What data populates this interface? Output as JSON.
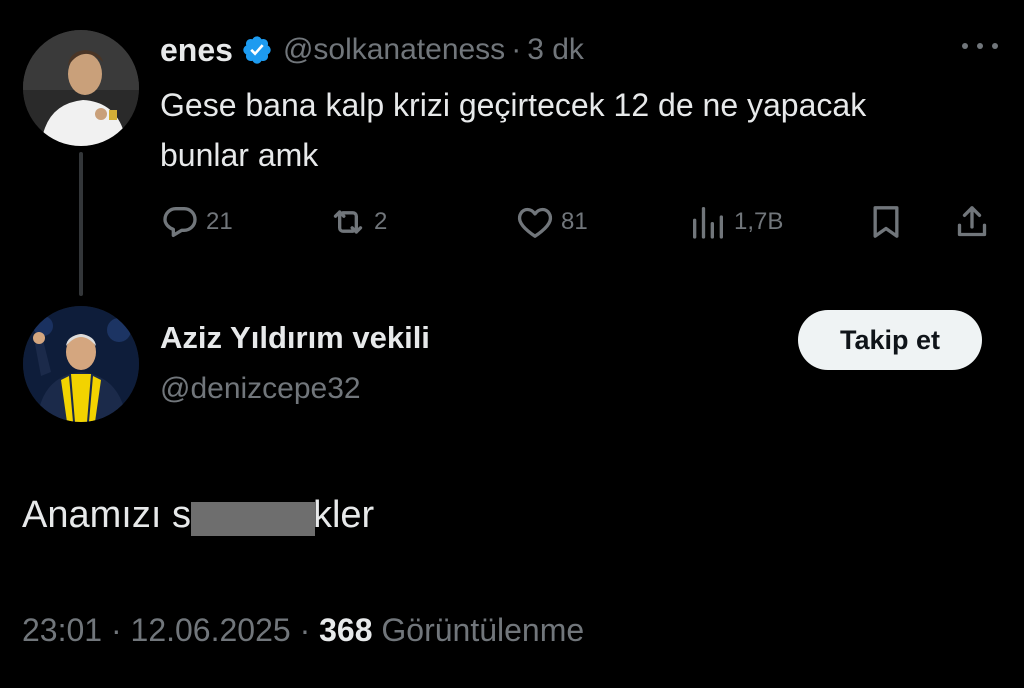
{
  "tweet1": {
    "name": "enes",
    "handle": "@solkanateness",
    "separator": "·",
    "time": "3 dk",
    "text": "Gese bana kalp krizi geçirtecek 12 de ne yapacak bunlar amk",
    "replies": "21",
    "retweets": "2",
    "likes": "81",
    "views": "1,7B",
    "icons": [
      "reply-icon",
      "retweet-icon",
      "like-icon",
      "views-icon",
      "bookmark-icon",
      "share-icon",
      "more-icon",
      "verified-icon"
    ]
  },
  "tweet2": {
    "name": "Aziz Yıldırım vekili",
    "handle": "@denizcepe32",
    "follow_label": "Takip et",
    "text_before": "Anamızı s",
    "text_after": "kler",
    "time": "23:01",
    "date": "12.06.2025",
    "separator": "·",
    "views_count": "368",
    "views_label": "Görüntülenme"
  },
  "colors": {
    "background": "#000000",
    "text": "#e7e9ea",
    "muted": "#71767b",
    "verified": "#1d9bf0",
    "button_bg": "#eff3f4"
  }
}
